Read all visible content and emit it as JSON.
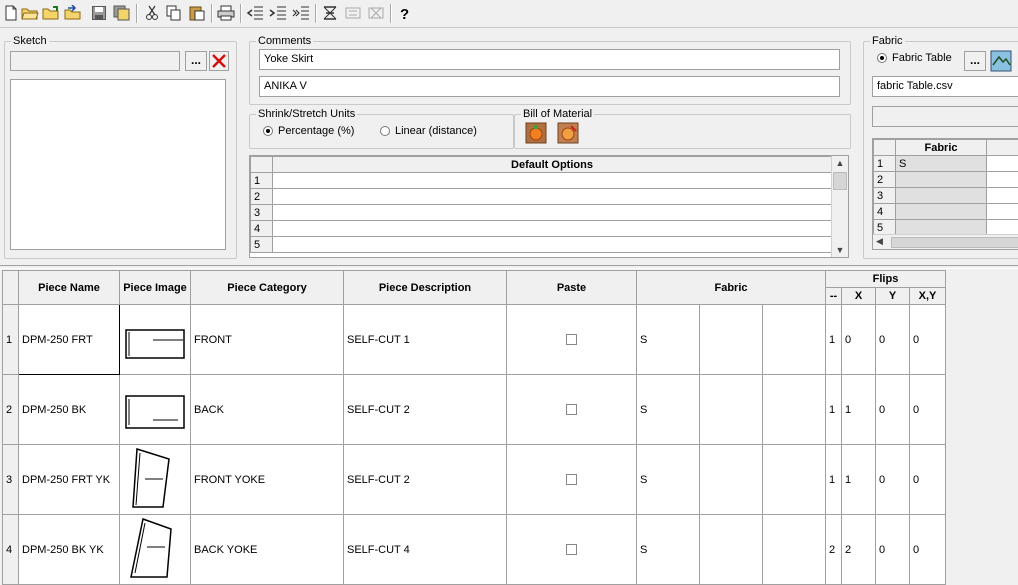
{
  "toolbar": {
    "buttons": [
      "new-file",
      "open-folder",
      "open",
      "import",
      "save",
      "save-all",
      "cut",
      "copy",
      "paste",
      "print",
      "indent-left",
      "indent-right",
      "indent-more",
      "sort",
      "edit-disabled",
      "delete-disabled",
      "help"
    ]
  },
  "sketch": {
    "title": "Sketch",
    "path_value": "",
    "browse_label": "..."
  },
  "comments": {
    "title": "Comments",
    "line1": "Yoke Skirt",
    "line2": "ANIKA V"
  },
  "shrink": {
    "title": "Shrink/Stretch Units",
    "options": [
      "Percentage (%)",
      "Linear (distance)"
    ],
    "selected": 0
  },
  "bom": {
    "title": "Bill of Material"
  },
  "default_options": {
    "header": "Default Options",
    "rows": [
      "1",
      "2",
      "3",
      "4",
      "5"
    ]
  },
  "fabric": {
    "title": "Fabric",
    "radio_label": "Fabric Table",
    "browse_label": "...",
    "file": "fabric Table.csv",
    "grid_header": "Fabric",
    "rows": [
      {
        "num": "1",
        "value": "S"
      },
      {
        "num": "2",
        "value": ""
      },
      {
        "num": "3",
        "value": ""
      },
      {
        "num": "4",
        "value": ""
      },
      {
        "num": "5",
        "value": ""
      }
    ]
  },
  "pieces": {
    "headers": {
      "name": "Piece Name",
      "image": "Piece Image",
      "category": "Piece Category",
      "description": "Piece Description",
      "paste": "Paste",
      "fabric": "Fabric",
      "flips": "Flips",
      "flip_dash": "--",
      "flip_x": "X",
      "flip_y": "Y",
      "flip_xy": "X,Y"
    },
    "rows": [
      {
        "num": "1",
        "name": "DPM-250 FRT",
        "category": "FRONT",
        "description": "SELF-CUT 1",
        "fabric": "S",
        "dash": "1",
        "x": "0",
        "y": "0",
        "xy": "0",
        "shape": "rect"
      },
      {
        "num": "2",
        "name": "DPM-250 BK",
        "category": "BACK",
        "description": "SELF-CUT 2",
        "fabric": "S",
        "dash": "1",
        "x": "1",
        "y": "0",
        "xy": "0",
        "shape": "rect"
      },
      {
        "num": "3",
        "name": "DPM-250 FRT YK",
        "category": "FRONT YOKE",
        "description": "SELF-CUT 2",
        "fabric": "S",
        "dash": "1",
        "x": "1",
        "y": "0",
        "xy": "0",
        "shape": "yoke"
      },
      {
        "num": "4",
        "name": "DPM-250 BK YK",
        "category": "BACK YOKE",
        "description": "SELF-CUT 4",
        "fabric": "S",
        "dash": "2",
        "x": "2",
        "y": "0",
        "xy": "0",
        "shape": "yoke2"
      }
    ]
  }
}
